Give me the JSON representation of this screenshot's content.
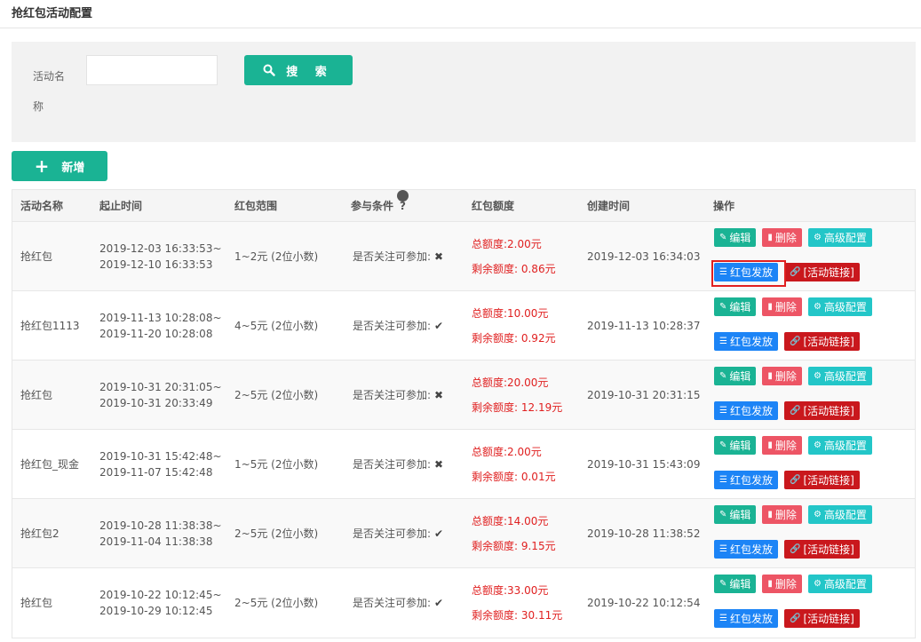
{
  "page": {
    "title": "抢红包活动配置"
  },
  "search": {
    "label": "活动名称",
    "value": "",
    "placeholder": "",
    "button_label": "搜 索"
  },
  "toolbar": {
    "add_label": "新增"
  },
  "table": {
    "headers": [
      "活动名称",
      "起止时间",
      "红包范围",
      "参与条件",
      "红包额度",
      "创建时间",
      "操作"
    ],
    "ops": {
      "edit": "编辑",
      "delete": "删除",
      "advanced": "高级配置",
      "send": "红包发放",
      "link": "[活动链接]"
    },
    "rows": [
      {
        "name": "抢红包",
        "start": "2019-12-03 16:33:53~",
        "end": "2019-12-10 16:33:53",
        "range": "1~2元  (2位小数)",
        "cond": "是否关注可参加:",
        "cond_mark": "✖",
        "total": "总额度:2.00元",
        "remain": "剩余额度:  0.86元",
        "created": "2019-12-03 16:34:03"
      },
      {
        "name": "抢红包1113",
        "start": "2019-11-13 10:28:08~",
        "end": "2019-11-20 10:28:08",
        "range": "4~5元  (2位小数)",
        "cond": "是否关注可参加:",
        "cond_mark": "✔",
        "total": "总额度:10.00元",
        "remain": "剩余额度:  0.92元",
        "created": "2019-11-13 10:28:37"
      },
      {
        "name": "抢红包",
        "start": "2019-10-31 20:31:05~",
        "end": "2019-10-31 20:33:49",
        "range": "2~5元  (2位小数)",
        "cond": "是否关注可参加:",
        "cond_mark": "✖",
        "total": "总额度:20.00元",
        "remain": "剩余额度:  12.19元",
        "created": "2019-10-31 20:31:15"
      },
      {
        "name": "抢红包_现金",
        "start": "2019-10-31 15:42:48~",
        "end": "2019-11-07 15:42:48",
        "range": "1~5元  (2位小数)",
        "cond": "是否关注可参加:",
        "cond_mark": "✖",
        "total": "总额度:2.00元",
        "remain": "剩余额度:  0.01元",
        "created": "2019-10-31 15:43:09"
      },
      {
        "name": "抢红包2",
        "start": "2019-10-28 11:38:38~",
        "end": "2019-11-04 11:38:38",
        "range": "2~5元  (2位小数)",
        "cond": "是否关注可参加:",
        "cond_mark": "✔",
        "total": "总额度:14.00元",
        "remain": "剩余额度:  9.15元",
        "created": "2019-10-28 11:38:52"
      },
      {
        "name": "抢红包",
        "start": "2019-10-22 10:12:45~",
        "end": "2019-10-29 10:12:45",
        "range": "2~5元  (2位小数)",
        "cond": "是否关注可参加:",
        "cond_mark": "✔",
        "total": "总额度:33.00元",
        "remain": "剩余额度:  30.11元",
        "created": "2019-10-22 10:12:54"
      }
    ]
  },
  "icons": {
    "search": "search-icon",
    "add": "plus-icon",
    "help": "help-icon",
    "edit": "edit-icon",
    "delete": "trash-icon",
    "advanced": "gears-icon",
    "send": "list-icon",
    "link": "link-icon"
  },
  "colors": {
    "primary": "#1ab394",
    "danger": "#ed5565",
    "info": "#23c6c8",
    "send": "#1c84f6",
    "link": "#c9181d",
    "quota": "#e02020"
  }
}
